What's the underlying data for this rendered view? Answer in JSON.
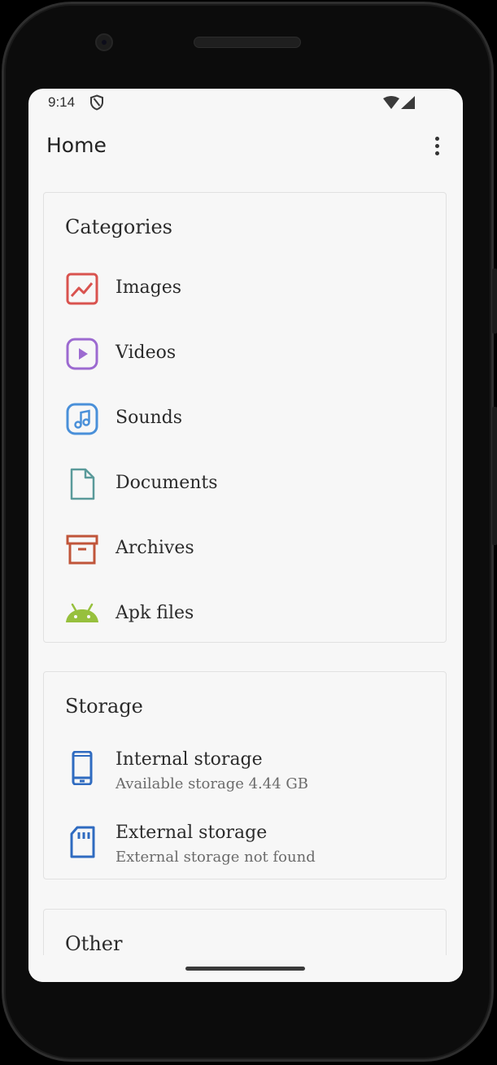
{
  "status_bar": {
    "time": "9:14"
  },
  "toolbar": {
    "title": "Home"
  },
  "categories": {
    "title": "Categories",
    "items": [
      {
        "label": "Images",
        "icon": "image-icon",
        "color": "#d9534f"
      },
      {
        "label": "Videos",
        "icon": "video-icon",
        "color": "#9c6ad0"
      },
      {
        "label": "Sounds",
        "icon": "music-icon",
        "color": "#4a90d9"
      },
      {
        "label": "Documents",
        "icon": "document-icon",
        "color": "#5a9a9a"
      },
      {
        "label": "Archives",
        "icon": "archive-icon",
        "color": "#c0553a"
      },
      {
        "label": "Apk files",
        "icon": "android-icon",
        "color": "#97c03d"
      }
    ]
  },
  "storage": {
    "title": "Storage",
    "items": [
      {
        "title": "Internal storage",
        "subtitle": "Available storage 4.44 GB",
        "icon": "phone-icon",
        "color": "#2f6bc0"
      },
      {
        "title": "External storage",
        "subtitle": "External storage not found",
        "icon": "sd-card-icon",
        "color": "#2f6bc0"
      }
    ]
  },
  "other": {
    "title": "Other"
  }
}
